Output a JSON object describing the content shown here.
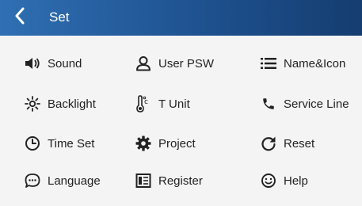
{
  "header": {
    "title": "Set",
    "back_icon": "chevron-left-icon"
  },
  "menu": {
    "items": [
      {
        "label": "Sound",
        "icon": "speaker-icon"
      },
      {
        "label": "User PSW",
        "icon": "user-icon"
      },
      {
        "label": "Name&Icon",
        "icon": "list-icon"
      },
      {
        "label": "Backlight",
        "icon": "brightness-icon"
      },
      {
        "label": "T Unit",
        "icon": "thermometer-icon"
      },
      {
        "label": "Service Line",
        "icon": "phone-icon"
      },
      {
        "label": "Time Set",
        "icon": "clock-icon"
      },
      {
        "label": "Project",
        "icon": "gear-icon"
      },
      {
        "label": "Reset",
        "icon": "refresh-icon"
      },
      {
        "label": "Language",
        "icon": "chat-bubble-icon"
      },
      {
        "label": "Register",
        "icon": "register-icon"
      },
      {
        "label": "Help",
        "icon": "smiley-icon"
      }
    ]
  },
  "colors": {
    "header_start": "#2f6fb3",
    "header_end": "#153d70",
    "background": "#f4f4f4",
    "text": "#222222"
  }
}
